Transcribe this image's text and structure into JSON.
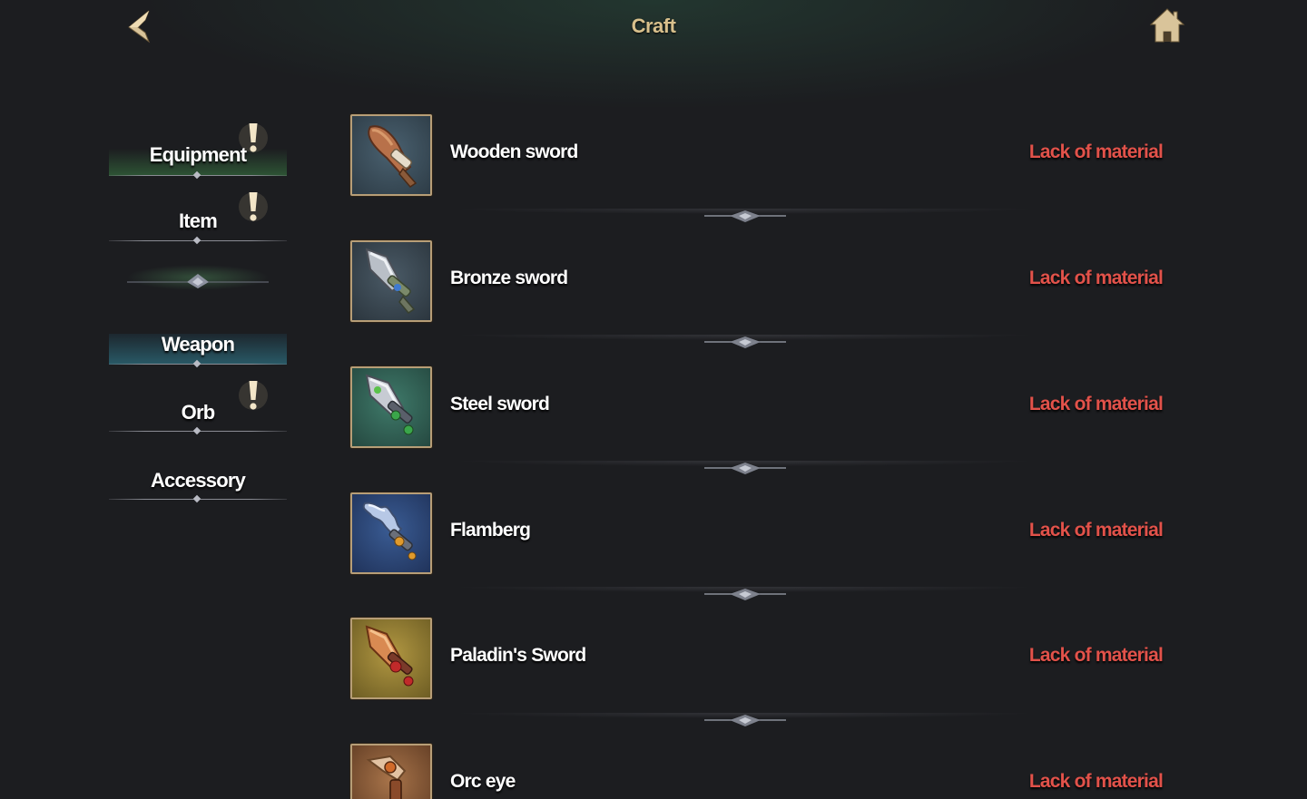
{
  "header": {
    "title": "Craft",
    "back_icon": "chevron-left-icon",
    "home_icon": "home-icon"
  },
  "sidebar": {
    "categories": [
      {
        "label": "Equipment",
        "alert": true,
        "active": true
      },
      {
        "label": "Item",
        "alert": true,
        "active": false
      }
    ],
    "subcategories": [
      {
        "label": "Weapon",
        "alert": false,
        "active": true
      },
      {
        "label": "Orb",
        "alert": true,
        "active": false
      },
      {
        "label": "Accessory",
        "alert": false,
        "active": false
      }
    ]
  },
  "items": [
    {
      "name": "Wooden sword",
      "status": "Lack of material",
      "icon": "wooden-sword-icon"
    },
    {
      "name": "Bronze sword",
      "status": "Lack of material",
      "icon": "bronze-sword-icon"
    },
    {
      "name": "Steel sword",
      "status": "Lack of material",
      "icon": "steel-sword-icon"
    },
    {
      "name": "Flamberg",
      "status": "Lack of material",
      "icon": "flamberg-icon"
    },
    {
      "name": "Paladin's Sword",
      "status": "Lack of material",
      "icon": "paladins-sword-icon"
    },
    {
      "name": "Orc eye",
      "status": "Lack of material",
      "icon": "orc-eye-icon"
    }
  ],
  "colors": {
    "title_gold": "#d8c08c",
    "status_red": "#e2524a",
    "alert_cream": "#f3e6c8",
    "background": "#1c1d20"
  }
}
